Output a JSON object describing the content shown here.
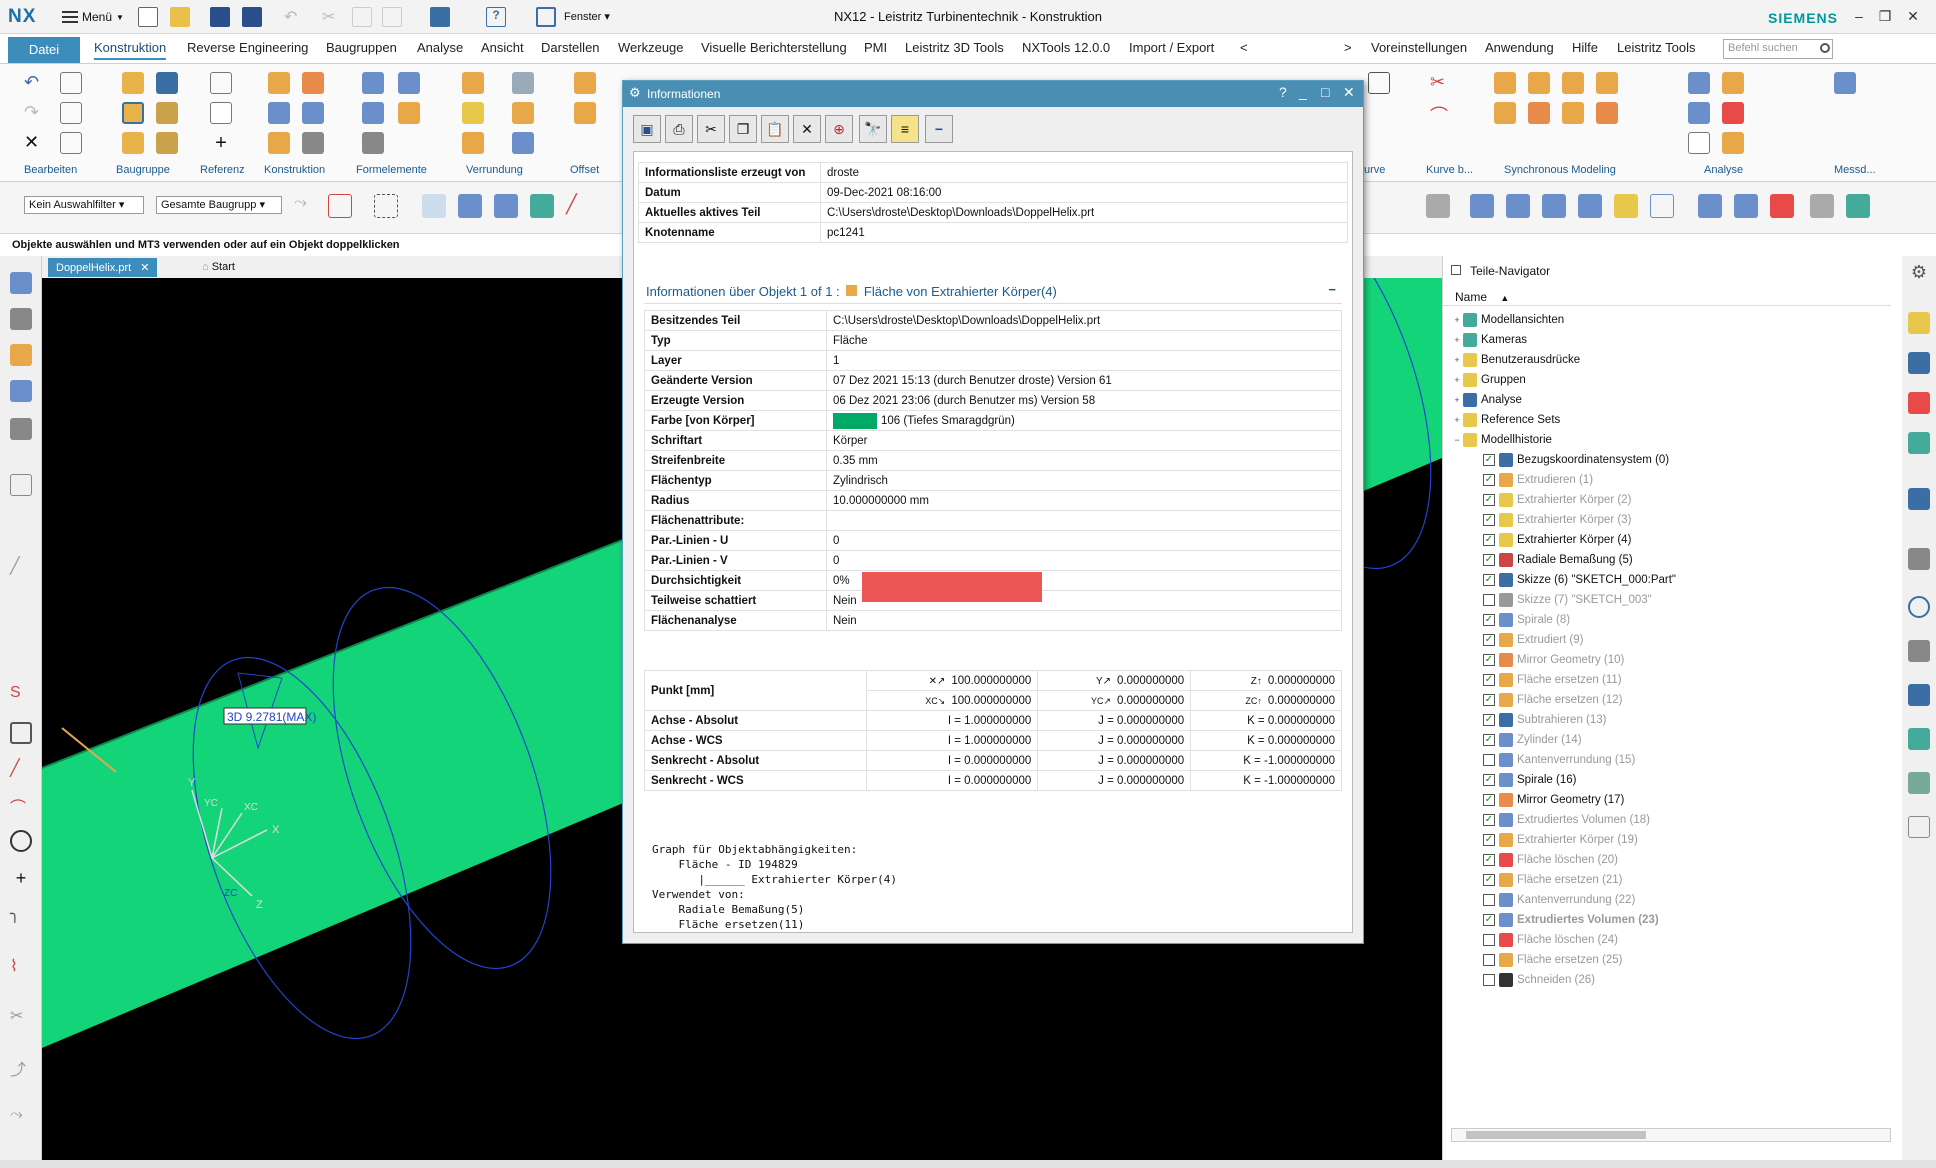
{
  "app": {
    "logo": "NX",
    "menu_label": "Menü",
    "window_label": "Fenster",
    "window_title": "NX12 - Leistritz Turbinentechnik - Konstruktion",
    "brand": "SIEMENS"
  },
  "tabs": {
    "file": "Datei",
    "items": [
      "Konstruktion",
      "Reverse Engineering",
      "Baugruppen",
      "Analyse",
      "Ansicht",
      "Darstellen",
      "Werkzeuge",
      "Visuelle Berichterstellung",
      "PMI",
      "Leistritz 3D Tools",
      "NXTools 12.0.0",
      "Import / Export",
      "<",
      ">",
      "Voreinstellungen",
      "Anwendung",
      "Hilfe",
      "Leistritz Tools"
    ],
    "search_placeholder": "Befehl suchen"
  },
  "ribbon": {
    "groups": [
      "Bearbeiten",
      "Baugruppe",
      "Referenz",
      "Konstruktion",
      "Formelemente",
      "Verrundung",
      "Offset",
      "urve",
      "Kurve b...",
      "Synchronous Modeling",
      "Analyse",
      "Messd..."
    ]
  },
  "selection": {
    "filter": "Kein Auswahlfilter",
    "scope": "Gesamte Baugrupp­"
  },
  "cue": "Objekte auswählen und MT3 verwenden oder auf ein Objekt doppelklicken",
  "doc_tabs": {
    "part": "DoppelHelix.prt",
    "start": "Start"
  },
  "viewport": {
    "annotation": "3D 9.2781(MAX)",
    "axes": [
      "X",
      "Y",
      "Z",
      "XC",
      "YC",
      "ZC"
    ]
  },
  "dialog": {
    "title": "Informationen",
    "header_rows": [
      {
        "k": "Informationsliste erzeugt von",
        "v": "droste"
      },
      {
        "k": "Datum",
        "v": "09-Dec-2021 08:16:00"
      },
      {
        "k": "Aktuelles aktives Teil",
        "v": "C:\\Users\\droste\\Desktop\\Downloads\\DoppelHelix.prt"
      },
      {
        "k": "Knotenname",
        "v": "pc1241"
      }
    ],
    "section_title": "Informationen über Objekt 1 of 1 :",
    "section_object": "Fläche von Extrahierter Körper(4)",
    "section_collapse": "−",
    "rows": [
      {
        "k": "Besitzendes Teil",
        "v": "C:\\Users\\droste\\Desktop\\Downloads\\DoppelHelix.prt"
      },
      {
        "k": "Typ",
        "v": "Fläche"
      },
      {
        "k": "Layer",
        "v": "1"
      },
      {
        "k": "Geänderte Version",
        "v": "07 Dez 2021 15:13 (durch Benutzer droste) Version 61"
      },
      {
        "k": "Erzeugte Version",
        "v": "06 Dez 2021 23:06 (durch Benutzer ms) Version 58"
      },
      {
        "k": "Farbe [von Körper]",
        "v": "106 (Tiefes Smaragdgrün)"
      },
      {
        "k": "Schriftart",
        "v": "Körper"
      },
      {
        "k": "Streifenbreite",
        "v": "0.35 mm"
      },
      {
        "k": "Flächentyp",
        "v": "Zylindrisch"
      },
      {
        "k": "Radius",
        "v": "10.000000000 mm"
      },
      {
        "k": "Flächenattribute:",
        "v": ""
      },
      {
        "k": "Par.-Linien - U",
        "v": "0"
      },
      {
        "k": "Par.-Linien - V",
        "v": "0"
      },
      {
        "k": "Durchsichtigkeit",
        "v": "0%"
      },
      {
        "k": "Teilweise schattiert",
        "v": "Nein"
      },
      {
        "k": "Flächenanalyse",
        "v": "Nein"
      }
    ],
    "swatch_color": "#00aa66",
    "point_label": "Punkt [mm]",
    "point_abs": [
      "100.000000000",
      "0.000000000",
      "0.000000000"
    ],
    "point_wcs": [
      "100.000000000",
      "0.000000000",
      "0.000000000"
    ],
    "vec_rows": [
      {
        "k": "Achse - Absolut",
        "i": "I = 1.000000000",
        "j": "J = 0.000000000",
        "kk": "K = 0.000000000"
      },
      {
        "k": "Achse - WCS",
        "i": "I = 1.000000000",
        "j": "J = 0.000000000",
        "kk": "K = 0.000000000"
      },
      {
        "k": "Senkrecht - Absolut",
        "i": "I = 0.000000000",
        "j": "J = 0.000000000",
        "kk": "K = -1.000000000"
      },
      {
        "k": "Senkrecht - WCS",
        "i": "I = 0.000000000",
        "j": "J = 0.000000000",
        "kk": "K = -1.000000000"
      }
    ],
    "graph_text": "Graph für Objektabhängigkeiten:\n    Fläche - ID 194829\n       |______ Extrahierter Körper(4)\nVerwendet von:\n    Radiale Bemaßung(5)\n    Fläche ersetzen(11)\n    Fläche ersetzen(12)\n    Fläche ersetzen(21)\n    Fläche ersetzen(25)"
  },
  "navigator": {
    "title": "Teile-Navigator",
    "column": "Name",
    "top_items": [
      "Modellansichten",
      "Kameras",
      "Benutzerausdrücke",
      "Gruppen",
      "Analyse",
      "Reference Sets",
      "Modellhistorie"
    ],
    "history": [
      {
        "label": "Bezugskoordinatensystem (0)",
        "checked": true,
        "state": "normal"
      },
      {
        "label": "Extrudieren (1)",
        "checked": true,
        "state": "grey"
      },
      {
        "label": "Extrahierter Körper (2)",
        "checked": true,
        "state": "grey"
      },
      {
        "label": "Extrahierter Körper (3)",
        "checked": true,
        "state": "grey"
      },
      {
        "label": "Extrahierter Körper (4)",
        "checked": true,
        "state": "normal"
      },
      {
        "label": "Radiale Bemaßung (5)",
        "checked": true,
        "state": "normal"
      },
      {
        "label": "Skizze (6) \"SKETCH_000:Part\"",
        "checked": true,
        "state": "normal"
      },
      {
        "label": "Skizze (7) \"SKETCH_003\"",
        "checked": false,
        "state": "grey"
      },
      {
        "label": "Spirale (8)",
        "checked": true,
        "state": "grey"
      },
      {
        "label": "Extrudiert (9)",
        "checked": true,
        "state": "grey"
      },
      {
        "label": "Mirror Geometry (10)",
        "checked": true,
        "state": "grey"
      },
      {
        "label": "Fläche ersetzen (11)",
        "checked": true,
        "state": "grey"
      },
      {
        "label": "Fläche ersetzen (12)",
        "checked": true,
        "state": "grey"
      },
      {
        "label": "Subtrahieren (13)",
        "checked": true,
        "state": "grey"
      },
      {
        "label": "Zylinder (14)",
        "checked": true,
        "state": "grey"
      },
      {
        "label": "Kantenverrundung (15)",
        "checked": false,
        "state": "grey"
      },
      {
        "label": "Spirale (16)",
        "checked": true,
        "state": "normal"
      },
      {
        "label": "Mirror Geometry (17)",
        "checked": true,
        "state": "normal"
      },
      {
        "label": "Extrudiertes Volumen (18)",
        "checked": true,
        "state": "grey"
      },
      {
        "label": "Extrahierter Körper (19)",
        "checked": true,
        "state": "grey"
      },
      {
        "label": "Fläche löschen (20)",
        "checked": true,
        "state": "grey"
      },
      {
        "label": "Fläche ersetzen (21)",
        "checked": true,
        "state": "grey"
      },
      {
        "label": "Kantenverrundung (22)",
        "checked": false,
        "state": "grey"
      },
      {
        "label": "Extrudiertes Volumen (23)",
        "checked": true,
        "state": "bold-grey"
      },
      {
        "label": "Fläche löschen (24)",
        "checked": false,
        "state": "grey"
      },
      {
        "label": "Fläche ersetzen (25)",
        "checked": false,
        "state": "grey"
      },
      {
        "label": "Schneiden (26)",
        "checked": false,
        "state": "grey"
      }
    ]
  }
}
